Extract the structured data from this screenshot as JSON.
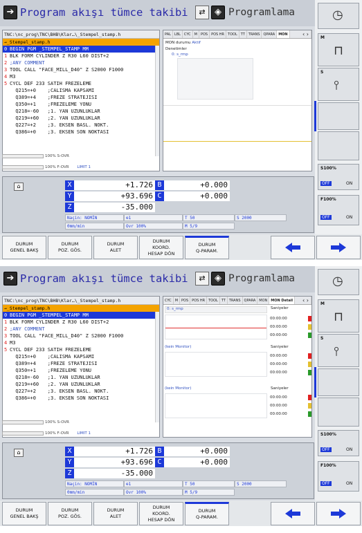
{
  "header": {
    "title": "Program akışı tümce takibi",
    "mode": "Programlama"
  },
  "program": {
    "path": "TNC:\\nc_prog\\TNC\\BHB\\Klar…\\_Stempel_stamp.h",
    "file": "→_Stempel_stamp.h",
    "lines": [
      {
        "n": "0",
        "t": "BEGIN PGM _STEMPEL_STAMP MM"
      },
      {
        "n": "1",
        "t": "BLK FORM CYLINDER Z R30 L60 DIST+2"
      },
      {
        "n": "2",
        "t": ";ANY COMMENT"
      },
      {
        "n": "3",
        "t": "TOOL CALL \"FACE_MILL_D40\" Z S2000 F1000"
      },
      {
        "n": "4",
        "t": "M3"
      },
      {
        "n": "5",
        "t": "CYCL DEF 233 SATIH FREZELEME"
      },
      {
        "n": "",
        "t": "  Q215=+0    ;CALISMA KAPSAMI"
      },
      {
        "n": "",
        "t": "  Q389=+4    ;FREZE STRATEJISI"
      },
      {
        "n": "",
        "t": "  Q350=+1    ;FREZELEME YONU"
      },
      {
        "n": "",
        "t": "  Q218=-60   ;1. YAN UZUNLUKLAR"
      },
      {
        "n": "",
        "t": "  Q219=+60   ;2. YAN UZUNLUKLAR"
      },
      {
        "n": "",
        "t": "  Q227=+2    ;3. EKSEN BASL. NOKT."
      },
      {
        "n": "",
        "t": "  Q386=+0    ;3. EKSEN SON NOKTASI"
      }
    ],
    "sovr": "100% S-OVR",
    "fovr": "100% F-OVR",
    "limit": "LIMIT 1"
  },
  "tabs1": [
    "PAL",
    "LBL",
    "CYC",
    "M",
    "POS",
    "POS HR",
    "TOOL",
    "TT",
    "TRANS",
    "QPARA",
    "MON"
  ],
  "tabs2": [
    "CYC",
    "M",
    "POS",
    "POS HR",
    "TOOL",
    "TT",
    "TRANS",
    "QPARA",
    "MON",
    "MON Detail"
  ],
  "mon": {
    "durum_label": "MON durumu",
    "durum_value": "Aktif",
    "denetimler": "Denetimler",
    "item": "0: s_rmp"
  },
  "mondetail": {
    "item": "0: s_rmp",
    "saniyeler": "Saniyeler",
    "time": "00:00:00",
    "kein": "(kein Monitor)"
  },
  "positions": {
    "x": "+1.726",
    "y": "+93.696",
    "z": "-35.000",
    "b": "+0.000",
    "c": "+0.000",
    "mode": "Naçin: NOMİN",
    "t": "T 50",
    "s": "S 2000",
    "f": "0mm/min",
    "ovr": "Ovr 100%",
    "m": "M 5/9",
    "tool_num": "1"
  },
  "sidebar": {
    "m": "M",
    "s": "S",
    "s100": "S100%",
    "f100": "F100%",
    "off": "OFF",
    "on": "ON"
  },
  "softkeys": [
    "DURUM\nGENEL BAKŞ",
    "DURUM\nPOZ. GÖS.",
    "DURUM\nALET",
    "DURUM\nKOORD.\nHESAP DÖN",
    "DURUM\nQ-PARAM."
  ],
  "colors": {
    "accent": "#1d39d8",
    "file_bar": "#f4a300",
    "red": "#e02020"
  }
}
